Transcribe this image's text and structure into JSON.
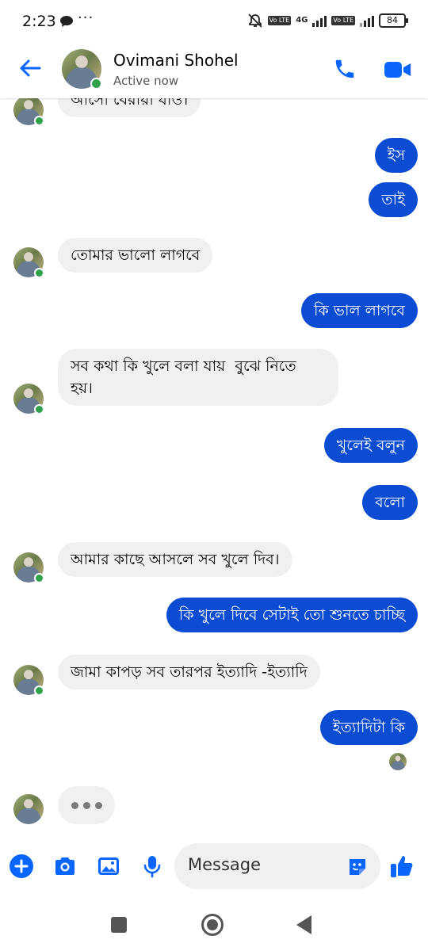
{
  "status_bar": {
    "time": "2:23",
    "dots": "···",
    "network": "4G",
    "volte_1": "Vo LTE",
    "volte_2": "Vo LTE",
    "battery": "84"
  },
  "header": {
    "back_icon": "arrow-left-icon",
    "contact_name": "Ovimani Shohel",
    "presence": "Active now",
    "call_icon": "phone-icon",
    "video_icon": "video-camera-icon",
    "accent_color": "#0866ff"
  },
  "conversation": {
    "messages": [
      {
        "from": "contact",
        "text": "আসো বেরায়া যাও।"
      },
      {
        "from": "me",
        "text": "ইস"
      },
      {
        "from": "me",
        "text": "তাই"
      },
      {
        "from": "contact",
        "text": "তোমার ভালো লাগবে"
      },
      {
        "from": "me",
        "text": "কি ভাল লাগবে"
      },
      {
        "from": "contact",
        "text": "সব কথা কি খুলে বলা যায়  বুঝে নিতে\nহয়।"
      },
      {
        "from": "me",
        "text": "খুলেই বলুন"
      },
      {
        "from": "me",
        "text": "বলো"
      },
      {
        "from": "contact",
        "text": "আমার কাছে আসলে সব খুলে দিব।"
      },
      {
        "from": "me",
        "text": "কি খুলে দিবে সেটাই তো শুনতে চাচ্ছি"
      },
      {
        "from": "contact",
        "text": "জামা কাপড় সব তারপর ইত্যাদি -ইত্যাদি"
      },
      {
        "from": "me",
        "text": "ইত্যাদিটা কি"
      }
    ],
    "typing_indicator": "typing-dots",
    "outgoing_color": "#0b4cd3",
    "incoming_color": "#f0f0f0"
  },
  "composer": {
    "add_icon": "plus-circle-icon",
    "camera_icon": "camera-icon",
    "gallery_icon": "image-icon",
    "mic_icon": "microphone-icon",
    "placeholder": "Message",
    "sticker_icon": "sticker-icon",
    "like_icon": "thumbs-up-icon"
  },
  "navbar": {
    "recents_icon": "square-icon",
    "home_icon": "circle-home-icon",
    "back_icon": "triangle-back-icon"
  }
}
